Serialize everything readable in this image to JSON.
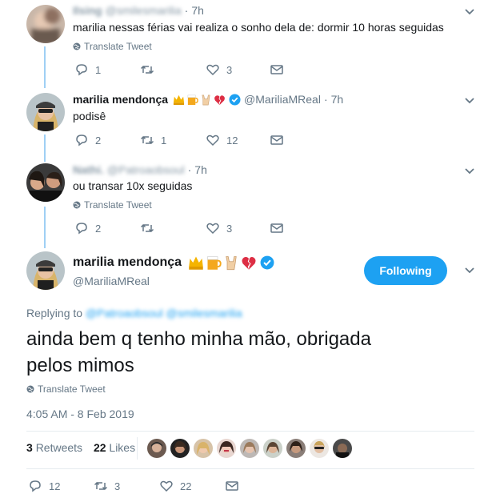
{
  "tweets": [
    {
      "name": "Ilsing",
      "handle": "@smilesmarilia",
      "time": "7h",
      "text": "marilia nessas férias vai realiza o sonho dela de: dormir 10 horas seguidas",
      "translate": "Translate Tweet",
      "replies": "1",
      "retweets": "",
      "likes": "3"
    },
    {
      "name": "marilia mendonça",
      "handle": "@MariliaMReal",
      "time": "7h",
      "text": "podisê",
      "replies": "2",
      "retweets": "1",
      "likes": "12"
    },
    {
      "name": "Nathi.",
      "handle": "@Patroaobsoul",
      "time": "7h",
      "text": "ou transar 10x seguidas",
      "translate": "Translate Tweet",
      "replies": "2",
      "retweets": "",
      "likes": "3"
    }
  ],
  "main_tweet": {
    "name": "marilia mendonça",
    "handle": "@MariliaMReal",
    "follow_label": "Following",
    "replying_to_label": "Replying to",
    "replying_to_handles": "@Patroaobsoul @smilesmarilia",
    "text_line1": "ainda bem q tenho minha mão, obrigada",
    "text_line2": "pelos mimos",
    "translate": "Translate Tweet",
    "timestamp": "4:05 AM - 8 Feb 2019",
    "retweets_count": "3",
    "retweets_label": "Retweets",
    "likes_count": "22",
    "likes_label": "Likes",
    "replies": "12",
    "retweets": "3",
    "likes": "22"
  },
  "colors": {
    "accent": "#1da1f2",
    "thread_line": "#9fd0f5",
    "secondary_text": "#657786",
    "verified": "#1da1f2",
    "heart_broken": "#e0245e"
  },
  "icons": [
    "reply-icon",
    "retweet-icon",
    "like-icon",
    "dm-icon",
    "globe-icon",
    "chevron-down-icon",
    "verified-icon"
  ]
}
